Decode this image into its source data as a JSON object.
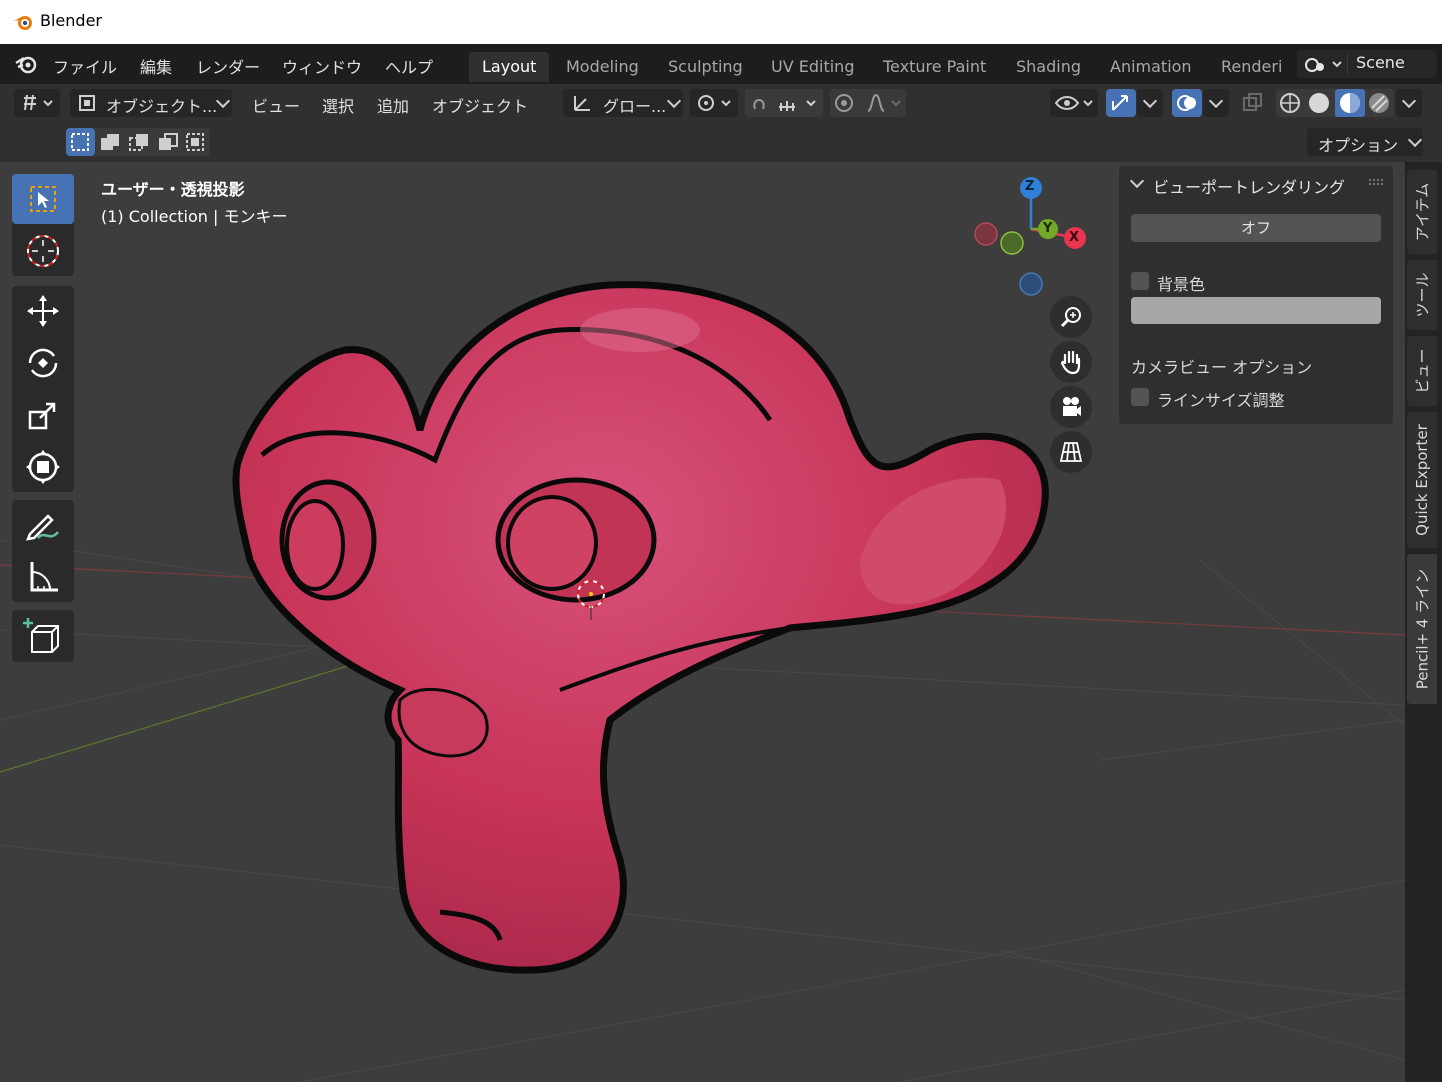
{
  "window": {
    "title": "Blender"
  },
  "menu": {
    "items": [
      "ファイル",
      "編集",
      "レンダー",
      "ウィンドウ",
      "ヘルプ"
    ]
  },
  "workspaces": {
    "tabs": [
      "Layout",
      "Modeling",
      "Sculpting",
      "UV Editing",
      "Texture Paint",
      "Shading",
      "Animation",
      "Renderi"
    ],
    "active": "Layout"
  },
  "scene": {
    "name": "Scene"
  },
  "header": {
    "mode": "オブジェクト...",
    "view": "ビュー",
    "select": "選択",
    "add": "追加",
    "object": "オブジェクト",
    "transform_orientation": "グロー...",
    "options": "オプション"
  },
  "viewport": {
    "view_label": "ユーザー・透視投影",
    "object_info": "(1) Collection | モンキー"
  },
  "gizmo": {
    "z": "Z",
    "y": "Y",
    "x": "X"
  },
  "npanel": {
    "title": "ビューポートレンダリング",
    "off_button": "オフ",
    "bg_color_label": "背景色",
    "camera_section": "カメラビュー オプション",
    "line_size_label": "ラインサイズ調整"
  },
  "sidetabs": [
    "アイテム",
    "ツール",
    "ビュー",
    "Quick Exporter",
    "Pencil+ 4 ライン"
  ],
  "colors": {
    "accent": "#4772b3",
    "monkey": "#d03a5e",
    "axis_x": "#e8364f",
    "axis_y": "#74a828",
    "axis_z": "#2f80d6"
  },
  "icons": [
    "blender-logo-icon",
    "select-box-icon",
    "cursor-icon",
    "move-icon",
    "rotate-icon",
    "scale-icon",
    "transform-icon",
    "annotate-icon",
    "measure-icon",
    "add-cube-icon",
    "zoom-icon",
    "hand-icon",
    "camera-icon",
    "grid-icon"
  ]
}
